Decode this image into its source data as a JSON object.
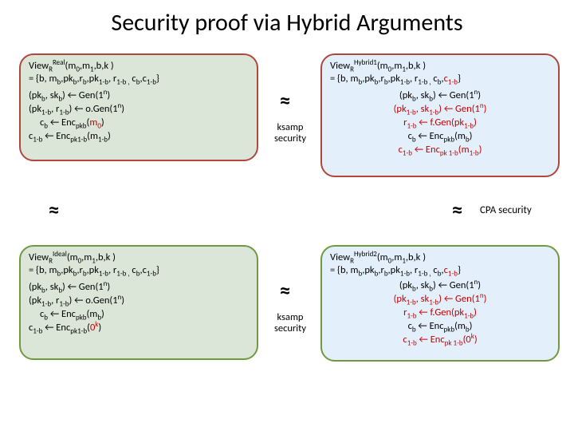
{
  "title": "Security proof via Hybrid Arguments",
  "labels": {
    "ksamp": "ksamp\nsecurity",
    "cpa": "CPA security"
  },
  "approx_symbol": "≈",
  "real": {
    "header_l1": "View_R^Real(m_0,m_1,b,k )",
    "header_l2": "= {b, m_b, pk_b, r_b, pk_{1-b}, r_{1-b}, c_b, c_{1-b}}",
    "line1": "(pk_b, sk_b) ← Gen(1^n)",
    "line2": "(pk_{1-b}, r_{1-b}) ← o.Gen(1^n)",
    "line3": "c_b ← Enc_{pkb}(m_0)",
    "line4": "c_{1-b} ← Enc_{pk1-b}(m_{1-b})"
  },
  "hyb1": {
    "header_l1": "View_R^Hybrid1(m_0,m_1,b,k )",
    "header_l2": "= {b, m_b, pk_b, r_b, pk_{1-b}, r_{1-b}, c_b, c_{1-b}}",
    "line1": "(pk_b, sk_b) ← Gen(1^n)",
    "line2": "(pk_{1-b}, sk_{1-b}) ← Gen(1^n)",
    "line3": "r_{1-b} ← f.Gen(pk_{1-b})",
    "line4": "c_b ← Enc_{pkb}(m_b)",
    "line5": "c_{1-b} ← Enc_{pk1-b}(m_{1-b})"
  },
  "ideal": {
    "header_l1": "View_R^Ideal(m_0,m_1,b,k )",
    "header_l2": "= {b, m_b, pk_b, r_b, pk_{1-b}, r_{1-b}, c_b, c_{1-b}}",
    "line1": "(pk_b, sk_b) ← Gen(1^n)",
    "line2": "(pk_{1-b}, r_{1-b}) ← o.Gen(1^n)",
    "line3": "c_b ← Enc_{pkb}(m_b)",
    "line4": "c_{1-b} ← Enc_{pk1-b}(0^k)"
  },
  "hyb2": {
    "header_l1": "View_R^Hybrid2(m_0,m_1,b,k )",
    "header_l2": "= {b, m_b, pk_b, r_b, pk_{1-b}, r_{1-b}, c_b, c_{1-b}}",
    "line1": "(pk_b, sk_b) ← Gen(1^n)",
    "line2": "(pk_{1-b}, sk_{1-b}) ← Gen(1^n)",
    "line3": "r_{1-b} ← f.Gen(pk_{1-b})",
    "line4": "c_b ← Enc_{pkb}(m_b)",
    "line5": "c_{1-b} ← Enc_{pk1-b}(0^k)"
  }
}
